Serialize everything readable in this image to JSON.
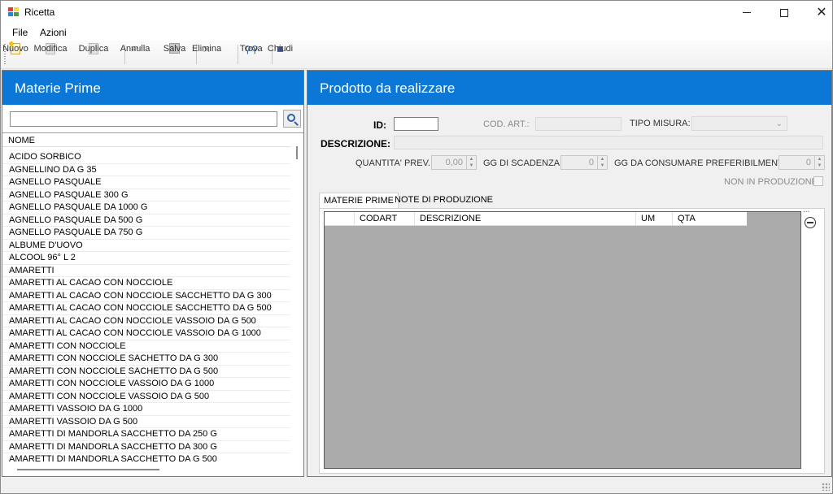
{
  "window": {
    "title": "Ricetta"
  },
  "menu": {
    "items": [
      "File",
      "Azioni"
    ]
  },
  "toolbar": {
    "buttons": [
      {
        "label": "Nuovo",
        "icon": "new-document-icon",
        "enabled": true
      },
      {
        "label": "Modifica",
        "icon": "edit-icon",
        "enabled": false
      },
      {
        "label": "Duplica",
        "icon": "duplicate-icon",
        "enabled": false
      },
      {
        "label": "Annulla",
        "icon": "undo-icon",
        "enabled": false
      },
      {
        "label": "Salva",
        "icon": "save-icon",
        "enabled": false
      },
      {
        "label": "Elimina",
        "icon": "delete-icon",
        "enabled": false
      },
      {
        "label": "Trova",
        "icon": "binoculars-icon",
        "enabled": true
      },
      {
        "label": "Chiudi",
        "icon": "stop-icon",
        "enabled": true
      }
    ]
  },
  "left": {
    "title": "Materie Prime",
    "search": {
      "value": "",
      "placeholder": ""
    },
    "list_header": "NOME",
    "items": [
      "ACIDO SORBICO",
      "AGNELLINO DA G 35",
      "AGNELLO PASQUALE",
      "AGNELLO PASQUALE 300 G",
      "AGNELLO PASQUALE DA 1000 G",
      "AGNELLO PASQUALE DA 500 G",
      "AGNELLO PASQUALE DA 750 G",
      "ALBUME D'UOVO",
      "ALCOOL 96° L 2",
      "AMARETTI",
      "AMARETTI  AL CACAO CON NOCCIOLE",
      "AMARETTI  AL CACAO CON NOCCIOLE  SACCHETTO DA G 300",
      "AMARETTI  AL CACAO CON NOCCIOLE  SACCHETTO DA G 500",
      "AMARETTI  AL CACAO CON NOCCIOLE  VASSOIO DA G 500",
      "AMARETTI  AL CACAO CON NOCCIOLE VASSOIO DA G 1000",
      "AMARETTI  CON NOCCIOLE",
      "AMARETTI  CON NOCCIOLE SACHETTO DA G 300",
      "AMARETTI  CON NOCCIOLE SACHETTO DA G 500",
      "AMARETTI  CON NOCCIOLE VASSOIO DA G 1000",
      "AMARETTI  CON NOCCIOLE VASSOIO DA G 500",
      "AMARETTI  VASSOIO DA G 1000",
      "AMARETTI  VASSOIO DA G 500",
      "AMARETTI DI MANDORLA SACCHETTO DA 250 G",
      "AMARETTI DI MANDORLA SACCHETTO DA 300 G",
      "AMARETTI DI MANDORLA SACCHETTO DA G 500"
    ]
  },
  "right": {
    "title": "Prodotto da realizzare",
    "id_label": "ID:",
    "id_value": "",
    "cod_art_label": "COD. ART.:",
    "cod_art_value": "",
    "tipo_misura_label": "TIPO MISURA:",
    "tipo_misura_value": "",
    "descrizione_label": "DESCRIZIONE:",
    "descrizione_value": "",
    "quantita_label": "QUANTITA' PREV.:",
    "quantita_value": "0,00",
    "gg_scadenza_label": "GG DI SCADENZA:",
    "gg_scadenza_value": "0",
    "gg_consumare_label": "GG DA CONSUMARE PREFERIBILMENTE:",
    "gg_consumare_value": "0",
    "non_in_produzione_label": "NON IN PRODUZIONE",
    "tabs": [
      "MATERIE PRIME",
      "NOTE DI PRODUZIONE"
    ],
    "grid_columns": [
      "CODART",
      "DESCRIZIONE",
      "UM",
      "QTA"
    ],
    "ellipsis": "..."
  },
  "colors": {
    "header_blue": "#0b78d7",
    "grid_gray": "#ababab"
  }
}
